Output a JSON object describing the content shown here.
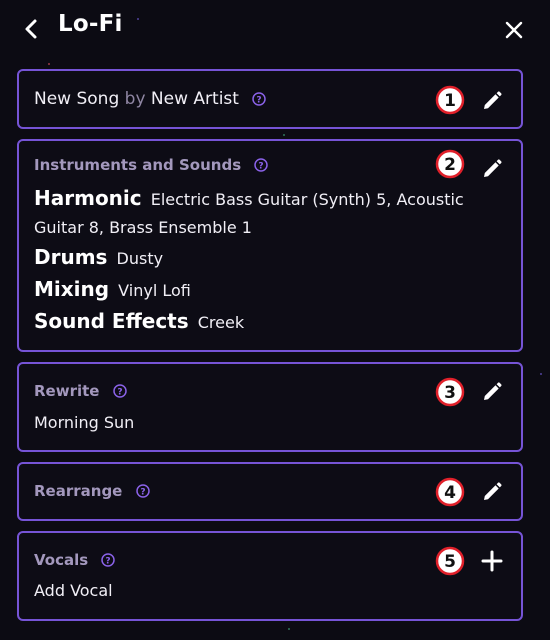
{
  "header": {
    "title": "Lo-Fi",
    "back_icon": "chevron-left-icon",
    "close_icon": "close-icon"
  },
  "colors": {
    "background": "#0c0b13",
    "card_border": "#7654d6",
    "help_icon": "#8a62e8",
    "badge_outline": "#e0202a",
    "muted_text": "#a398bd"
  },
  "song": {
    "name": "New Song",
    "by": "by",
    "artist": "New Artist",
    "badge": "1",
    "action_icon": "pencil-icon"
  },
  "instruments": {
    "title": "Instruments and Sounds",
    "badge": "2",
    "action_icon": "pencil-icon",
    "harmonic_label": "Harmonic",
    "harmonic_value": "Electric Bass Guitar (Synth) 5, Acoustic Guitar 8, Brass Ensemble 1",
    "drums_label": "Drums",
    "drums_value": "Dusty",
    "mixing_label": "Mixing",
    "mixing_value": "Vinyl Lofi",
    "effects_label": "Sound Effects",
    "effects_value": "Creek"
  },
  "rewrite": {
    "title": "Rewrite",
    "value": "Morning Sun",
    "badge": "3",
    "action_icon": "pencil-icon"
  },
  "rearrange": {
    "title": "Rearrange",
    "badge": "4",
    "action_icon": "pencil-icon"
  },
  "vocals": {
    "title": "Vocals",
    "value": "Add Vocal",
    "badge": "5",
    "action_icon": "plus-icon"
  }
}
